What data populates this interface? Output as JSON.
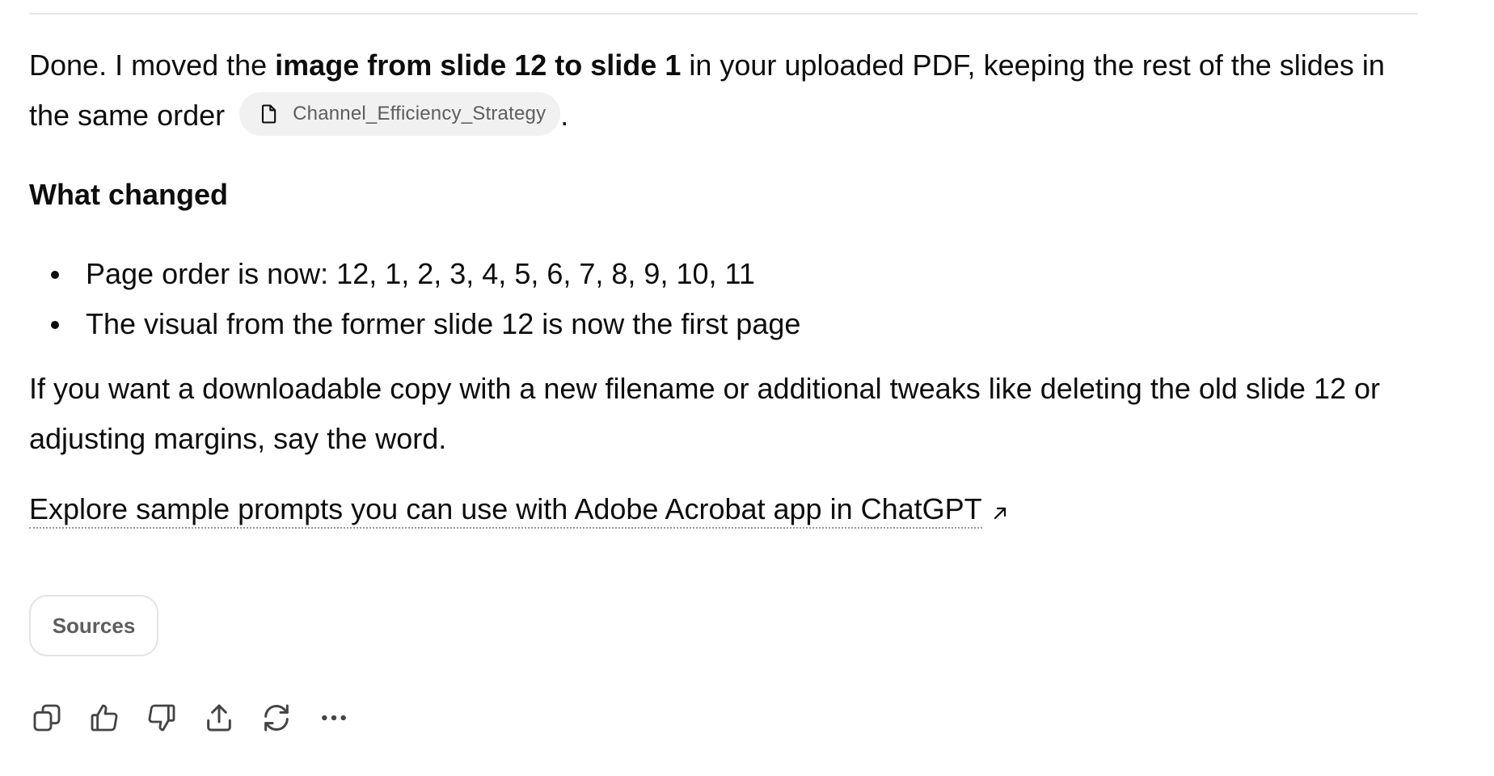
{
  "message": {
    "intro_prefix": "Done. I moved the ",
    "intro_bold": "image from slide 12 to slide 1",
    "intro_suffix": " in your uploaded PDF, keeping the rest of the slides in the same order",
    "intro_end": ".",
    "file_chip": {
      "label": "Channel_Efficiency_Strategy",
      "icon": "file-icon"
    },
    "heading": "What changed",
    "bullets": [
      "Page order is now: 12, 1, 2, 3, 4, 5, 6, 7, 8, 9, 10, 11",
      "The visual from the former slide 12 is now the first page"
    ],
    "followup": "If you want a downloadable copy with a new filename or additional tweaks like deleting the old slide 12 or adjusting margins, say the word.",
    "explore_link": "Explore sample prompts you can use with Adobe Acrobat app in ChatGPT",
    "explore_icon": "external-arrow-icon"
  },
  "sources_button": "Sources",
  "actions": [
    {
      "name": "copy",
      "icon": "copy-icon"
    },
    {
      "name": "thumbs-up",
      "icon": "thumbs-up-icon"
    },
    {
      "name": "thumbs-down",
      "icon": "thumbs-down-icon"
    },
    {
      "name": "share",
      "icon": "share-icon"
    },
    {
      "name": "regenerate",
      "icon": "regenerate-icon"
    },
    {
      "name": "more",
      "icon": "more-icon"
    }
  ],
  "colors": {
    "text": "#0d0d0d",
    "muted": "#5d5d5d",
    "chip_bg": "#f1f1f1",
    "border": "#e3e3e3"
  }
}
